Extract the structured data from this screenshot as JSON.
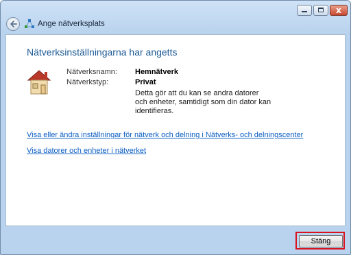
{
  "window": {
    "title": "Ange nätverksplats",
    "close_glyph": "x"
  },
  "heading": "Nätverksinställningarna har angetts",
  "network": {
    "name_label": "Nätverksnamn:",
    "name_value": "Hemnätverk",
    "type_label": "Nätverkstyp:",
    "type_value": "Privat",
    "description": "Detta gör att du kan se andra datorer och enheter, samtidigt som din dator kan identifieras."
  },
  "links": {
    "settings": "Visa eller ändra inställningar för nätverk och delning i Nätverks- och delningscenter",
    "devices": "Visa datorer och enheter i nätverket"
  },
  "buttons": {
    "close_label": "Stäng"
  },
  "icons": {
    "back": "back-arrow-icon",
    "network": "network-icon",
    "home": "home-network-icon"
  },
  "colors": {
    "heading": "#1d5a95",
    "link": "#0b5ec4",
    "highlight": "#d9141e"
  }
}
